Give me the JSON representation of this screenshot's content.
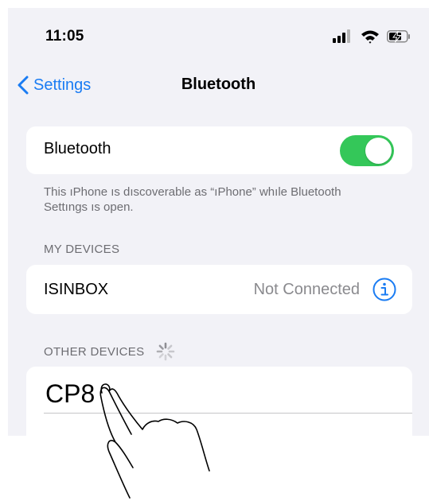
{
  "status_bar": {
    "time": "11:05",
    "icons": [
      "cellular-signal-icon",
      "wifi-icon",
      "battery-charging-icon"
    ]
  },
  "nav": {
    "back_label": "Settings",
    "title": "Bluetooth"
  },
  "bluetooth_row": {
    "label": "Bluetooth",
    "toggle_on": true
  },
  "discoverable_note": "This ıPhone ıs dıscoverable as “ıPhone” whıle Bluetooth Settıngs ıs open.",
  "my_devices": {
    "header": "MY DEVICES",
    "devices": [
      {
        "name": "ISINBOX",
        "status": "Not Connected"
      }
    ]
  },
  "other_devices": {
    "header": "OTHER DEVICES",
    "devices": [
      {
        "name": "CP8"
      }
    ]
  },
  "colors": {
    "accent": "#1a7cf3",
    "toggle_on": "#34c759",
    "background": "#f2f2f7",
    "secondary_text": "#6d6d72"
  }
}
